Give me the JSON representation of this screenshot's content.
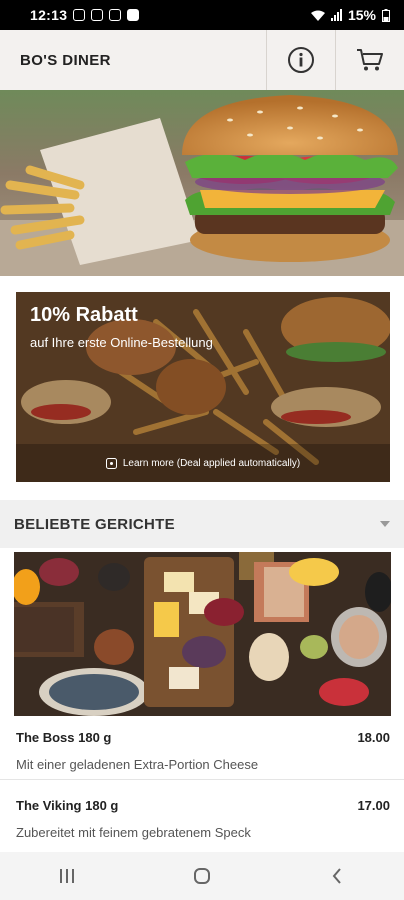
{
  "status_bar": {
    "time": "12:13",
    "battery": "15%"
  },
  "header": {
    "title": "BO'S DINER",
    "info_icon": "info-icon",
    "cart_icon": "cart-icon"
  },
  "promo": {
    "title": "10% Rabatt",
    "subtitle": "auf Ihre erste Online-Bestellung",
    "link": "Learn more (Deal applied automatically)"
  },
  "section": {
    "title": "BELIEBTE GERICHTE"
  },
  "items": [
    {
      "name": "The Boss 180 g",
      "price": "18.00",
      "desc": "Mit einer geladenen Extra-Portion Cheese"
    },
    {
      "name": "The Viking 180 g",
      "price": "17.00",
      "desc": "Zubereitet mit feinem gebratenem Speck"
    }
  ],
  "nav": {
    "recents": "recents-icon",
    "home": "home-icon",
    "back": "back-icon"
  }
}
